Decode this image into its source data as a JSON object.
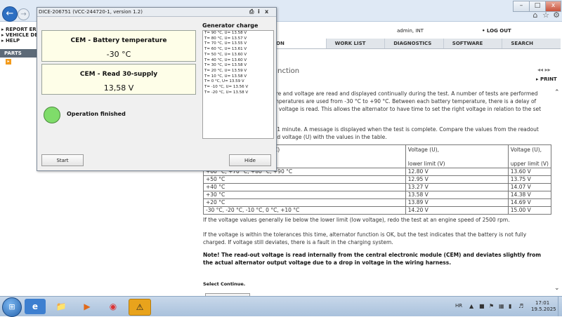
{
  "browser": {
    "back_icon": "back-arrow-icon",
    "forward_icon": "forward-arrow-icon",
    "window_controls": [
      "–",
      "□",
      "x"
    ],
    "toolbar_icons": [
      "home-icon",
      "star-icon",
      "gear-icon"
    ]
  },
  "left_menu": {
    "items": [
      "REPORT ERR",
      "VEHICLE DE",
      "HELP"
    ],
    "parts_tab": "PARTS"
  },
  "header": {
    "user": "admin, INT",
    "logout": "LOG OUT",
    "tabs": [
      "ON",
      "WORK LIST",
      "DIAGNOSTICS",
      "SOFTWARE",
      "SEARCH"
    ]
  },
  "document": {
    "title": "r function",
    "nav_arrows": "◂◂   ▸▸",
    "print": "PRINT",
    "paragraph1": [
      "ture and voltage are read and displayed continually during the test. A number of tests are performed",
      "emperatures are used from -30 °C to +90 °C. Between each battery temperature, there is a delay of",
      "he voltage is read. This allows the alternator to have time to set the right voltage in relation to the set"
    ],
    "paragraph2": [
      "x. 1 minute. A message is displayed when the test is complete. Compare the values from the readout",
      " and voltage (U) with the values in the table."
    ],
    "table": {
      "header": [
        "C)",
        "Voltage (U),\n\nlower limit (V)",
        "Voltage (U),\n\nupper limit (V)"
      ],
      "rows": [
        [
          "+60 °C, +70 °C, +80 °C, +90 °C",
          "12.80 V",
          "13.60 V"
        ],
        [
          "+50 °C",
          "12.95 V",
          "13.75 V"
        ],
        [
          "+40 °C",
          "13.27 V",
          "14.07 V"
        ],
        [
          "+30 °C",
          "13.58 V",
          "14.38 V"
        ],
        [
          "+20 °C",
          "13.89 V",
          "14.69 V"
        ],
        [
          "-30 °C, -20 °C, -10 °C, 0 °C, +10 °C",
          "14.20 V",
          "15.00 V"
        ]
      ]
    },
    "paragraph3": "If the voltage values generally lie below the lower limit (low voltage), redo the test at an engine speed of 2500 rpm.",
    "paragraph4": [
      "If the voltage is within the tolerances this time, alternator function is OK, but the test indicates that the battery is not fully",
      "charged. If voltage still deviates, there is a fault in the charging system."
    ],
    "note": [
      "Note! The read-out voltage is read internally from the central electronic module (CEM) and deviates slightly from",
      "the actual alternator output voltage due to a drop in voltage in the wiring harness."
    ],
    "select_continue": "Select Continue."
  },
  "dialog": {
    "title": "DICE-206751  (VCC-244720-1, version 1.2)",
    "controls": [
      "print-icon",
      "info-icon",
      "close-icon"
    ],
    "reading1": {
      "label": "CEM - Battery temperature",
      "value": "-30 °C"
    },
    "reading2": {
      "label": "CEM - Read 30-supply",
      "value": "13,58 V"
    },
    "status": "Operation finished",
    "status_color": "#7fdc6a",
    "start_button": "Start",
    "hide_button": "Hide",
    "generator_title": "Generator charge",
    "generator_log": [
      "T= 90 °C,  U= 13.58 V",
      "T= 80 °C,  U= 13.57 V",
      "T= 70 °C,  U= 13.55 V",
      "T= 60 °C,  U= 13.61 V",
      "T= 50 °C,  U= 13.60 V",
      "T= 40 °C,  U= 13.60 V",
      "T= 30 °C,  U= 13.58 V",
      "T= 20 °C,  U= 13.59 V",
      "T= 10 °C,  U= 13.58 V",
      "T= 0 °C,  U= 13.59 V",
      "T= -10 °C,  U= 13.56 V",
      "T= -20 °C,  U= 13.58 V"
    ]
  },
  "taskbar": {
    "apps": [
      "ie-icon",
      "explorer-folder-icon",
      "media-player-icon",
      "chrome-icon",
      "warning-app-icon"
    ],
    "language": "HR",
    "time": "17:01",
    "date": "19.5.2025"
  }
}
